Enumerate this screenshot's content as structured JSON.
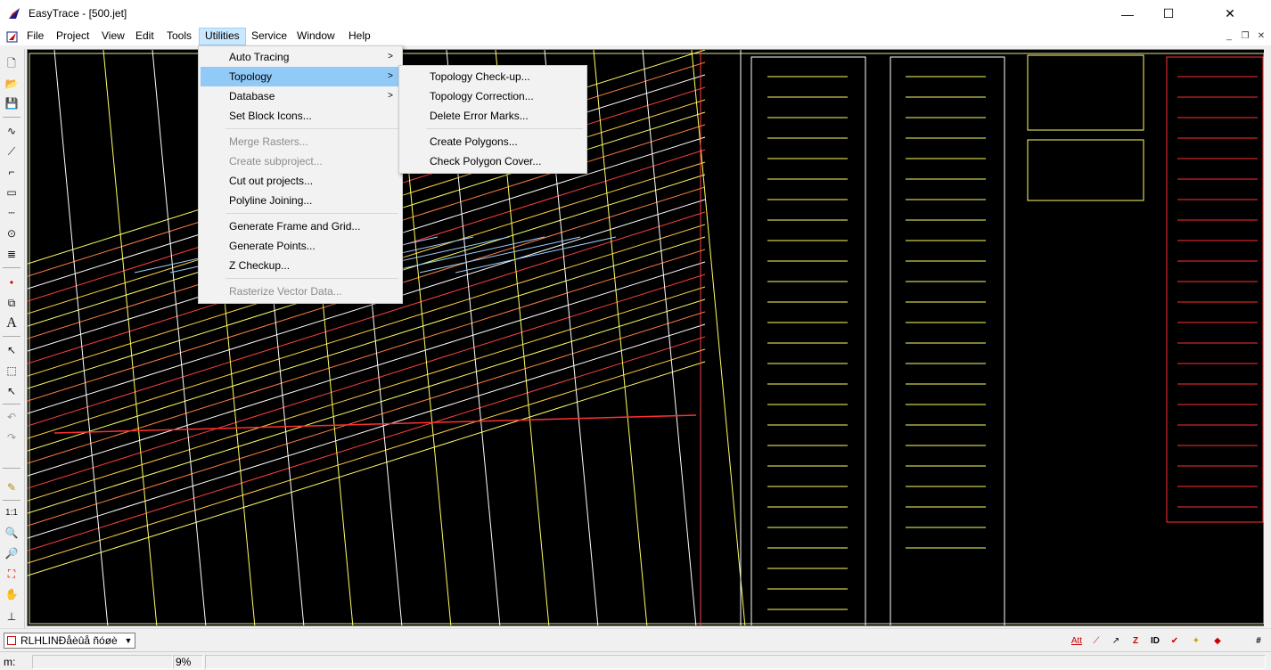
{
  "window": {
    "title": "EasyTrace - [500.jet]",
    "minimize_glyph": "—",
    "maximize_glyph": "☐",
    "close_glyph": "✕"
  },
  "menubar": {
    "items": [
      "File",
      "Project",
      "View",
      "Edit",
      "Tools",
      "Utilities",
      "Service",
      "Window",
      "Help"
    ],
    "active": "Utilities",
    "mdi_buttons": [
      "_",
      "❐",
      "✕"
    ]
  },
  "utilities_menu": {
    "items": [
      {
        "label": "Auto Tracing",
        "submenu": true,
        "enabled": true
      },
      {
        "label": "Topology",
        "submenu": true,
        "enabled": true,
        "highlighted": true
      },
      {
        "label": "Database",
        "submenu": true,
        "enabled": true
      },
      {
        "label": "Set Block Icons...",
        "enabled": true
      },
      {
        "label": "Merge Rasters...",
        "enabled": false
      },
      {
        "label": "Create subproject...",
        "enabled": false
      },
      {
        "label": "Cut out projects...",
        "enabled": true
      },
      {
        "label": "Polyline Joining...",
        "enabled": true
      },
      {
        "label": "Generate Frame and Grid...",
        "enabled": true
      },
      {
        "label": "Generate Points...",
        "enabled": true
      },
      {
        "label": "Z Checkup...",
        "enabled": true
      },
      {
        "label": "Rasterize Vector Data...",
        "enabled": false
      }
    ],
    "submenu_arrow": ">"
  },
  "topology_submenu": {
    "items": [
      {
        "label": "Topology Check-up..."
      },
      {
        "label": "Topology Correction..."
      },
      {
        "label": "Delete Error Marks..."
      },
      {
        "label": "Create Polygons..."
      },
      {
        "label": "Check Polygon Cover..."
      }
    ]
  },
  "left_toolbar": {
    "tools": [
      {
        "name": "new-project-icon",
        "glyph": "🗋"
      },
      {
        "name": "open-project-icon",
        "glyph": "📂"
      },
      {
        "name": "save-icon",
        "glyph": "💾"
      },
      {
        "name": "curve-tool-icon",
        "glyph": "∿"
      },
      {
        "name": "polyline-tool-icon",
        "glyph": "⟋"
      },
      {
        "name": "orthogonal-line-icon",
        "glyph": "⌐"
      },
      {
        "name": "rectangle-tool-icon",
        "glyph": "▭"
      },
      {
        "name": "dashed-line-icon",
        "glyph": "┄"
      },
      {
        "name": "circle-tool-icon",
        "glyph": "⊙"
      },
      {
        "name": "hatch-tool-icon",
        "glyph": "≣"
      },
      {
        "name": "point-tool-icon",
        "glyph": "•"
      },
      {
        "name": "block-tool-icon",
        "glyph": "⧉"
      },
      {
        "name": "text-tool-icon",
        "glyph": "A"
      },
      {
        "name": "select-arrow-icon",
        "glyph": "↖"
      },
      {
        "name": "select-area-icon",
        "glyph": "⬚"
      },
      {
        "name": "select-node-icon",
        "glyph": "↖"
      },
      {
        "name": "undo-icon",
        "glyph": "↶"
      },
      {
        "name": "redo-icon",
        "glyph": "↷"
      },
      {
        "name": "pencil-icon",
        "glyph": "✎"
      },
      {
        "name": "zoom-1-1-icon",
        "glyph": "1:1"
      },
      {
        "name": "zoom-in-icon",
        "glyph": "🔍"
      },
      {
        "name": "zoom-out-icon",
        "glyph": "🔎"
      },
      {
        "name": "zoom-extents-icon",
        "glyph": "⛶"
      },
      {
        "name": "pan-hand-icon",
        "glyph": "✋"
      },
      {
        "name": "measure-icon",
        "glyph": "⊥"
      }
    ]
  },
  "layer_selector": {
    "value": "RLHLINÐåèûå ñóøè",
    "swatch_color": "#cc0000"
  },
  "right_toolbar": {
    "tools": [
      {
        "name": "attribute-icon",
        "glyph": "Att"
      },
      {
        "name": "snap-line-icon",
        "glyph": "⟋"
      },
      {
        "name": "arrow-tool-icon",
        "glyph": "↗"
      },
      {
        "name": "z-value-icon",
        "glyph": "Z"
      },
      {
        "name": "id-icon",
        "glyph": "ID"
      },
      {
        "name": "check-icon",
        "glyph": "✔"
      },
      {
        "name": "magic-wand-icon",
        "glyph": "✦"
      },
      {
        "name": "fill-icon",
        "glyph": "◆"
      },
      {
        "name": "grid-icon",
        "glyph": "#"
      }
    ]
  },
  "statusbar": {
    "coord_label": "m:",
    "coord_value": "",
    "zoom_value": "9%"
  },
  "colors": {
    "menu_highlight": "#91c9f7",
    "menubar_active": "#cce8ff",
    "canvas_bg": "#000000"
  }
}
